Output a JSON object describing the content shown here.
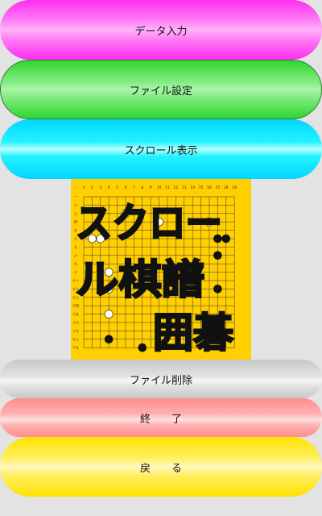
{
  "buttons": {
    "data_input": "データ入力",
    "file_settings": "ファイル設定",
    "scroll_display": "スクロール表示",
    "file_delete": "ファイル削除",
    "exit": "終　　了",
    "back": "戻　　る"
  },
  "banner": {
    "title_line1": "スクロー",
    "title_line2": "ル棋譜",
    "title_line3": "囲碁",
    "board_size": 19,
    "column_labels": [
      "1",
      "2",
      "3",
      "4",
      "5",
      "6",
      "7",
      "8",
      "9",
      "10",
      "11",
      "12",
      "13",
      "14",
      "15",
      "16",
      "17",
      "18",
      "19"
    ],
    "row_labels": [
      "一",
      "二",
      "三",
      "四",
      "五",
      "六",
      "七",
      "八",
      "九",
      "十",
      "十一",
      "十二",
      "十三",
      "十四",
      "十五",
      "十六",
      "十七",
      "十八",
      "十九"
    ],
    "colors": {
      "background": "#ffcf00",
      "text": "#111111"
    }
  }
}
